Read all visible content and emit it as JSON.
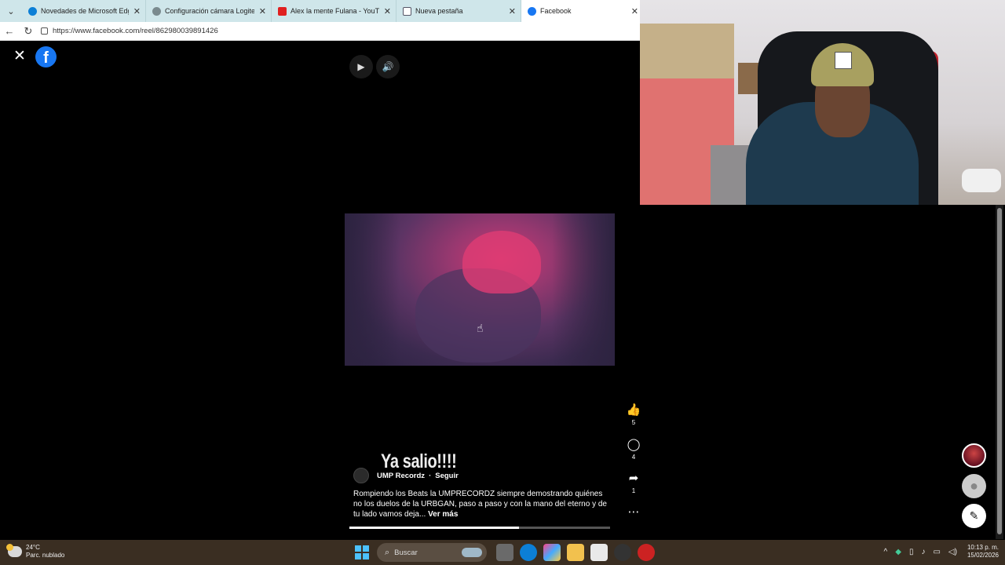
{
  "browser": {
    "tabs": [
      {
        "label": "Novedades de Microsoft Edge",
        "icon": "edge-icon",
        "color": "#0c7fd6"
      },
      {
        "label": "Configuración cámara Logitech",
        "icon": "settings-icon",
        "color": "#7a8a8e"
      },
      {
        "label": "Alex la mente Fulana - YouTube",
        "icon": "youtube-icon",
        "color": "#e02020"
      },
      {
        "label": "Nueva pestaña",
        "icon": "newtab-icon",
        "color": "#556"
      },
      {
        "label": "Facebook",
        "icon": "facebook-icon",
        "color": "#1877f2"
      }
    ],
    "active_tab": 4,
    "url": "https://www.facebook.com/reel/862980039891426"
  },
  "reel": {
    "overlay_title": "Ya salio!!!!",
    "author": "UMP Recordz",
    "follow_label": "Seguir",
    "caption": "Rompiendo los Beats la UMPRECORDZ siempre demostrando quiénes no los duelos de la URBGAN, paso a paso y con la mano del eterno y de tu lado vamos deja...",
    "see_more": "Ver más",
    "progress_fraction": 0.65,
    "likes": "5",
    "comments": "4",
    "shares": "1"
  },
  "taskbar": {
    "temperature": "24°C",
    "weather": "Parc. nublado",
    "search_placeholder": "Buscar",
    "time": "10:13 p. m.",
    "date": "15/02/2026"
  }
}
